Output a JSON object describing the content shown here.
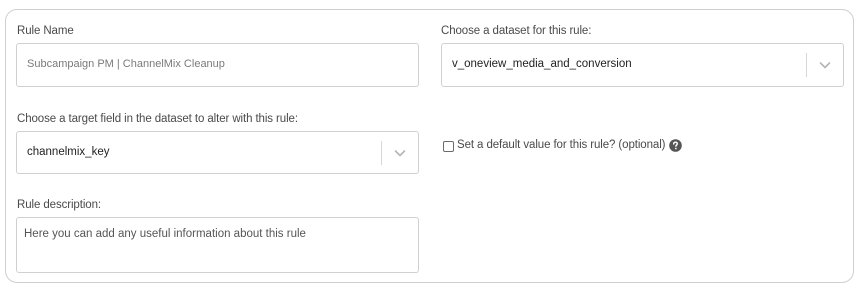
{
  "rule_name": {
    "label": "Rule Name",
    "value": "Subcampaign PM | ChannelMix Cleanup"
  },
  "dataset": {
    "label": "Choose a dataset for this rule:",
    "selected": "v_oneview_media_and_conversion"
  },
  "target_field": {
    "label": "Choose a target field in the dataset to alter with this rule:",
    "selected": "channelmix_key"
  },
  "default_value": {
    "label": "Set a default value for this rule? (optional)",
    "checked": false,
    "help_icon": "question-circle-icon"
  },
  "description": {
    "label": "Rule description:",
    "placeholder": "Here you can add any useful information about this rule"
  },
  "icons": {
    "dropdown": "chevron-down-icon"
  }
}
